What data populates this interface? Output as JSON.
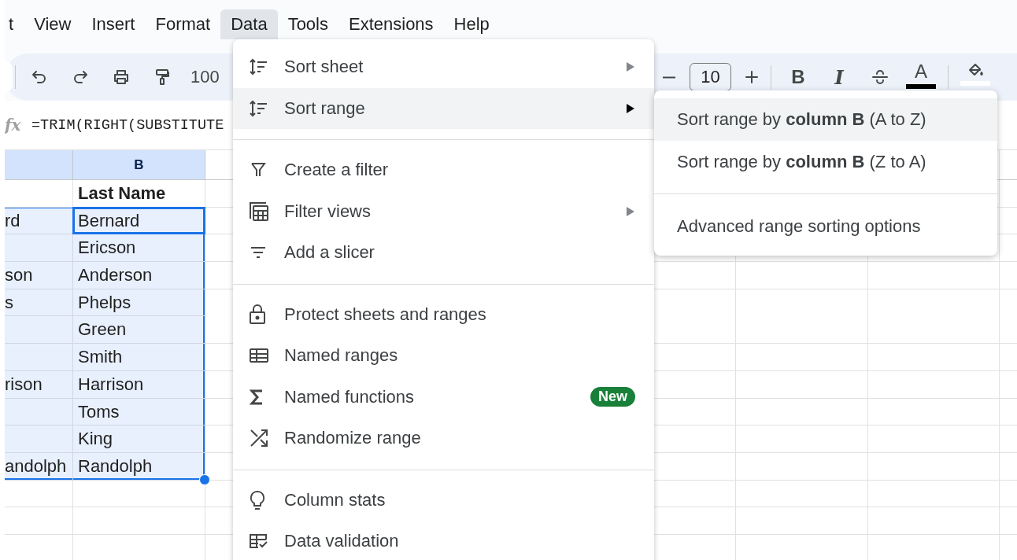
{
  "menubar": {
    "items": [
      {
        "label": "t",
        "selected": false
      },
      {
        "label": "View",
        "selected": false
      },
      {
        "label": "Insert",
        "selected": false
      },
      {
        "label": "Format",
        "selected": false
      },
      {
        "label": "Data",
        "selected": true
      },
      {
        "label": "Tools",
        "selected": false
      },
      {
        "label": "Extensions",
        "selected": false
      },
      {
        "label": "Help",
        "selected": false
      }
    ]
  },
  "toolbar": {
    "zoom": "100",
    "font_size": "10",
    "bold": "B",
    "italic": "I",
    "text_color_glyph": "A"
  },
  "formula_bar": {
    "function_label": "fx",
    "formula": "=TRIM(RIGHT(SUBSTITUTE"
  },
  "grid": {
    "columns": [
      {
        "selected": true
      },
      {
        "label": "B",
        "selected": true
      }
    ],
    "rows": [
      {
        "kind": "header",
        "column_b": "Last Name",
        "selected": false,
        "active": false
      },
      {
        "kind": "data",
        "column_a": "rd",
        "column_b": "Bernard",
        "selected": true,
        "active": true
      },
      {
        "kind": "data",
        "column_b": "Ericson",
        "selected": true,
        "active": false
      },
      {
        "kind": "data",
        "column_a": "son",
        "column_b": "Anderson",
        "selected": true,
        "active": false
      },
      {
        "kind": "data",
        "column_a": "s",
        "column_b": "Phelps",
        "selected": true,
        "active": false
      },
      {
        "kind": "data",
        "column_b": "Green",
        "selected": true,
        "active": false
      },
      {
        "kind": "data",
        "column_b": "Smith",
        "selected": true,
        "active": false
      },
      {
        "kind": "data",
        "column_a": "rison",
        "column_b": "Harrison",
        "selected": true,
        "active": false
      },
      {
        "kind": "data",
        "column_b": "Toms",
        "selected": true,
        "active": false
      },
      {
        "kind": "data",
        "column_b": "King",
        "selected": true,
        "active": false
      },
      {
        "kind": "data",
        "column_a": "andolph",
        "column_b": "Randolph",
        "selected": true,
        "active": false
      }
    ]
  },
  "data_menu": {
    "sections": [
      {
        "items": [
          {
            "label": "Sort sheet",
            "submenu": true,
            "selected": false
          },
          {
            "label": "Sort range",
            "submenu": true,
            "selected": true
          }
        ]
      },
      {
        "items": [
          {
            "label": "Create a filter",
            "submenu": false,
            "selected": false
          },
          {
            "label": "Filter views",
            "submenu": true,
            "selected": false
          },
          {
            "label": "Add a slicer",
            "submenu": false,
            "selected": false
          }
        ]
      },
      {
        "items": [
          {
            "label": "Protect sheets and ranges",
            "submenu": false,
            "selected": false
          },
          {
            "label": "Named ranges",
            "submenu": false,
            "selected": false
          },
          {
            "label": "Named functions",
            "submenu": false,
            "selected": false,
            "badge": "New"
          },
          {
            "label": "Randomize range",
            "submenu": false,
            "selected": false
          }
        ]
      },
      {
        "items": [
          {
            "label": "Column stats",
            "submenu": false,
            "selected": false
          },
          {
            "label": "Data validation",
            "submenu": false,
            "selected": false
          }
        ]
      }
    ]
  },
  "submenu": {
    "sections": [
      {
        "items": [
          {
            "label": "Sort range by **column B** (A to Z)",
            "selected": true
          },
          {
            "label": "Sort range by **column B** (Z to A)",
            "selected": false
          }
        ]
      },
      {
        "items": [
          {
            "label": "Advanced range sorting options",
            "selected": false
          }
        ]
      }
    ]
  }
}
